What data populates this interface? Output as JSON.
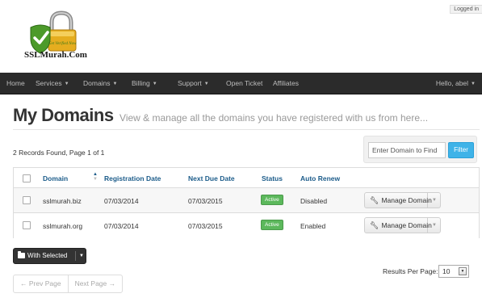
{
  "brand": {
    "name": "SSLMurah.Com",
    "tagline": "Get Verified Now"
  },
  "header": {
    "logged_in_label": "Logged in"
  },
  "nav": {
    "items": [
      {
        "label": "Home",
        "dropdown": false
      },
      {
        "label": "Services",
        "dropdown": true
      },
      {
        "label": "Domains",
        "dropdown": true
      },
      {
        "label": "Billing",
        "dropdown": true
      },
      {
        "label": "Support",
        "dropdown": true
      },
      {
        "label": "Open Ticket",
        "dropdown": false
      },
      {
        "label": "Affiliates",
        "dropdown": false
      }
    ],
    "user_greeting": "Hello, abel"
  },
  "page": {
    "title": "My Domains",
    "subtitle": "View & manage all the domains you have registered with us from here...",
    "records_text": "2 Records Found, Page 1 of 1"
  },
  "search": {
    "placeholder": "Enter Domain to Find",
    "button_label": "Filter"
  },
  "table": {
    "columns": [
      "Domain",
      "Registration Date",
      "Next Due Date",
      "Status",
      "Auto Renew"
    ],
    "sorted_column": "Domain",
    "rows": [
      {
        "domain": "sslmurah.biz",
        "registration_date": "07/03/2014",
        "next_due_date": "07/03/2015",
        "status": "Active",
        "auto_renew": "Disabled",
        "action_label": "Manage Domain"
      },
      {
        "domain": "sslmurah.org",
        "registration_date": "07/03/2014",
        "next_due_date": "07/03/2015",
        "status": "Active",
        "auto_renew": "Enabled",
        "action_label": "Manage Domain"
      }
    ]
  },
  "bulk": {
    "with_selected_label": "With Selected"
  },
  "pagination": {
    "prev_label": "← Prev Page",
    "next_label": "Next Page →"
  },
  "results_per_page": {
    "label": "Results Per Page:",
    "value": "10"
  },
  "colors": {
    "navbar_bg": "#2b2b2b",
    "accent": "#3fb3e8",
    "status_active": "#5cb85c",
    "link": "#1e6aa5"
  },
  "icons": {
    "logo": "padlock-checkmark-logo",
    "manage": "wrench-icon",
    "bulk": "folder-icon",
    "dropdown": "caret-down-icon"
  }
}
